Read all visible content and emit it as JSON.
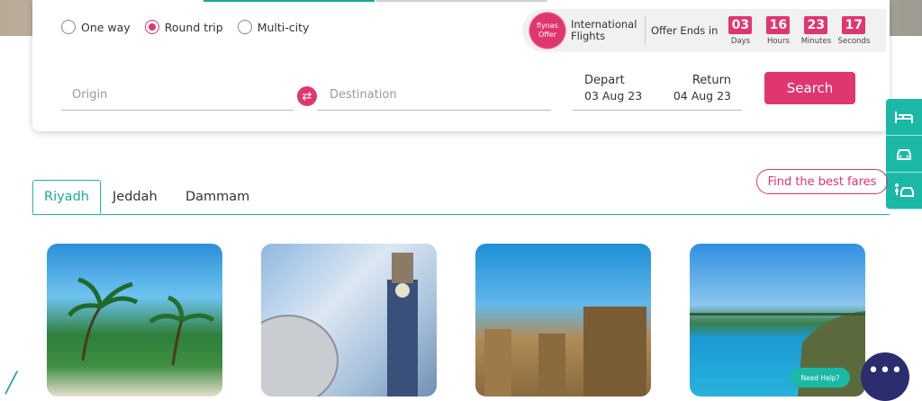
{
  "trip_types": [
    {
      "label": "One way",
      "selected": false
    },
    {
      "label": "Round trip",
      "selected": true
    },
    {
      "label": "Multi-city",
      "selected": false
    }
  ],
  "offer": {
    "badge_line1": "flynas",
    "badge_line2": "Offer",
    "title_line1": "International",
    "title_line2": "Flights",
    "ends_label": "Offer Ends in",
    "countdown": [
      {
        "value": "03",
        "label": "Days"
      },
      {
        "value": "16",
        "label": "Hours"
      },
      {
        "value": "23",
        "label": "Minutes"
      },
      {
        "value": "17",
        "label": "Seconds"
      }
    ]
  },
  "search": {
    "origin_placeholder": "Origin",
    "destination_placeholder": "Destination",
    "depart_label": "Depart",
    "depart_value": "03 Aug 23",
    "return_label": "Return",
    "return_value": "04 Aug 23",
    "search_button": "Search"
  },
  "city_tabs": [
    "Riyadh",
    "Jeddah",
    "Dammam"
  ],
  "best_fares_button": "Find the best fares",
  "side_rail_icons": [
    "bed-icon",
    "car-icon",
    "person-car-icon"
  ],
  "need_help": "Need Help?",
  "colors": {
    "accent": "#e0366f",
    "teal": "#1bb8a6",
    "chat": "#2b2d6e"
  }
}
